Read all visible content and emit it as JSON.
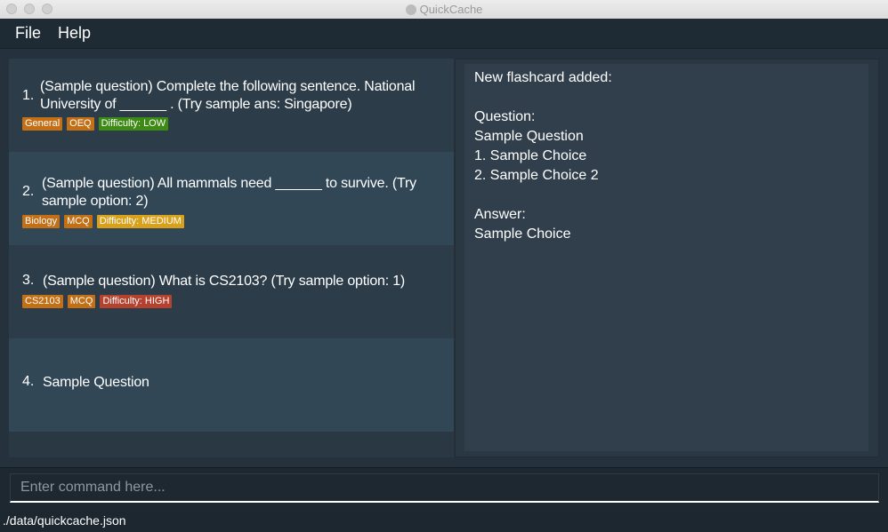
{
  "window": {
    "title": "QuickCache"
  },
  "menu": {
    "file": "File",
    "help": "Help"
  },
  "flashcards": [
    {
      "index": "1.",
      "question": "(Sample question) Complete the following sentence. National University of ______ . (Try sample ans: Singapore)",
      "tags": [
        {
          "label": "General",
          "color": "orange"
        },
        {
          "label": "OEQ",
          "color": "orange"
        },
        {
          "label": "Difficulty: LOW",
          "color": "green"
        }
      ]
    },
    {
      "index": "2.",
      "question": "(Sample question) All mammals need ______ to survive. (Try sample option: 2)",
      "tags": [
        {
          "label": "Biology",
          "color": "orange"
        },
        {
          "label": "MCQ",
          "color": "orange"
        },
        {
          "label": "Difficulty: MEDIUM",
          "color": "yellow"
        }
      ]
    },
    {
      "index": "3.",
      "question": "(Sample question) What is CS2103? (Try sample option: 1)",
      "tags": [
        {
          "label": "CS2103",
          "color": "orange"
        },
        {
          "label": "MCQ",
          "color": "orange"
        },
        {
          "label": "Difficulty: HIGH",
          "color": "red"
        }
      ]
    },
    {
      "index": "4.",
      "question": "Sample Question",
      "tags": []
    }
  ],
  "result": {
    "lines": [
      "New flashcard added:",
      "",
      "Question:",
      "Sample Question",
      "1. Sample Choice",
      "2. Sample Choice 2",
      "",
      "Answer:",
      "Sample Choice"
    ]
  },
  "command": {
    "placeholder": "Enter command here...",
    "value": ""
  },
  "status": {
    "path": "./data/quickcache.json"
  },
  "colors": {
    "tag_orange": "#c36f15",
    "tag_green": "#3d8a14",
    "tag_yellow": "#d8a11c",
    "tag_red": "#b5422e"
  }
}
